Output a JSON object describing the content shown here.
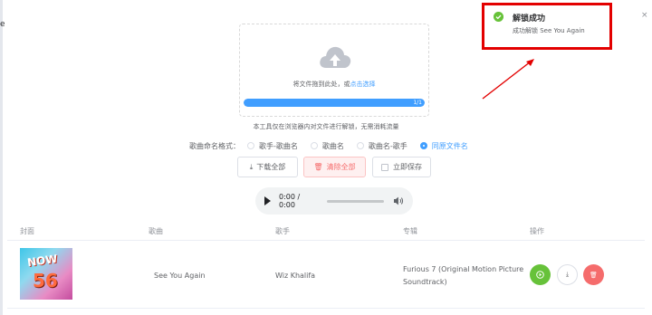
{
  "left_edge_char": "e",
  "uploader": {
    "text_prefix": "将文件拖到此处，或",
    "text_link": "点击选择",
    "progress_text": "1/1",
    "progress_fraction": 1.0
  },
  "tip": "本工具仅在浏览器内对文件进行解锁，无需消耗流量",
  "naming": {
    "label": "歌曲命名格式：",
    "options": [
      "歌手-歌曲名",
      "歌曲名",
      "歌曲名-歌手",
      "同原文件名"
    ],
    "selected": "同原文件名"
  },
  "buttons": {
    "download_all": "下载全部",
    "clear_all": "清除全部",
    "save_now": "立即保存"
  },
  "player": {
    "time": "0:00 / 0:00"
  },
  "table": {
    "headers": [
      "封面",
      "歌曲",
      "歌手",
      "专辑",
      "操作"
    ],
    "rows": [
      {
        "cover_text_1": "NOW",
        "cover_text_2": "56",
        "song": "See You Again",
        "artist": "Wiz Khalifa",
        "album": "Furious 7 (Original Motion Picture Soundtrack)"
      }
    ]
  },
  "notification": {
    "title": "解锁成功",
    "message": "成功解锁 See You Again",
    "close": "×"
  },
  "colors": {
    "accent": "#409eff",
    "success": "#67c23a",
    "danger": "#f56c6c",
    "highlight": "#e30000"
  },
  "icons": [
    "cloud-upload-icon",
    "download-icon",
    "delete-icon",
    "play-icon",
    "volume-icon",
    "check-circle-icon",
    "close-icon"
  ]
}
